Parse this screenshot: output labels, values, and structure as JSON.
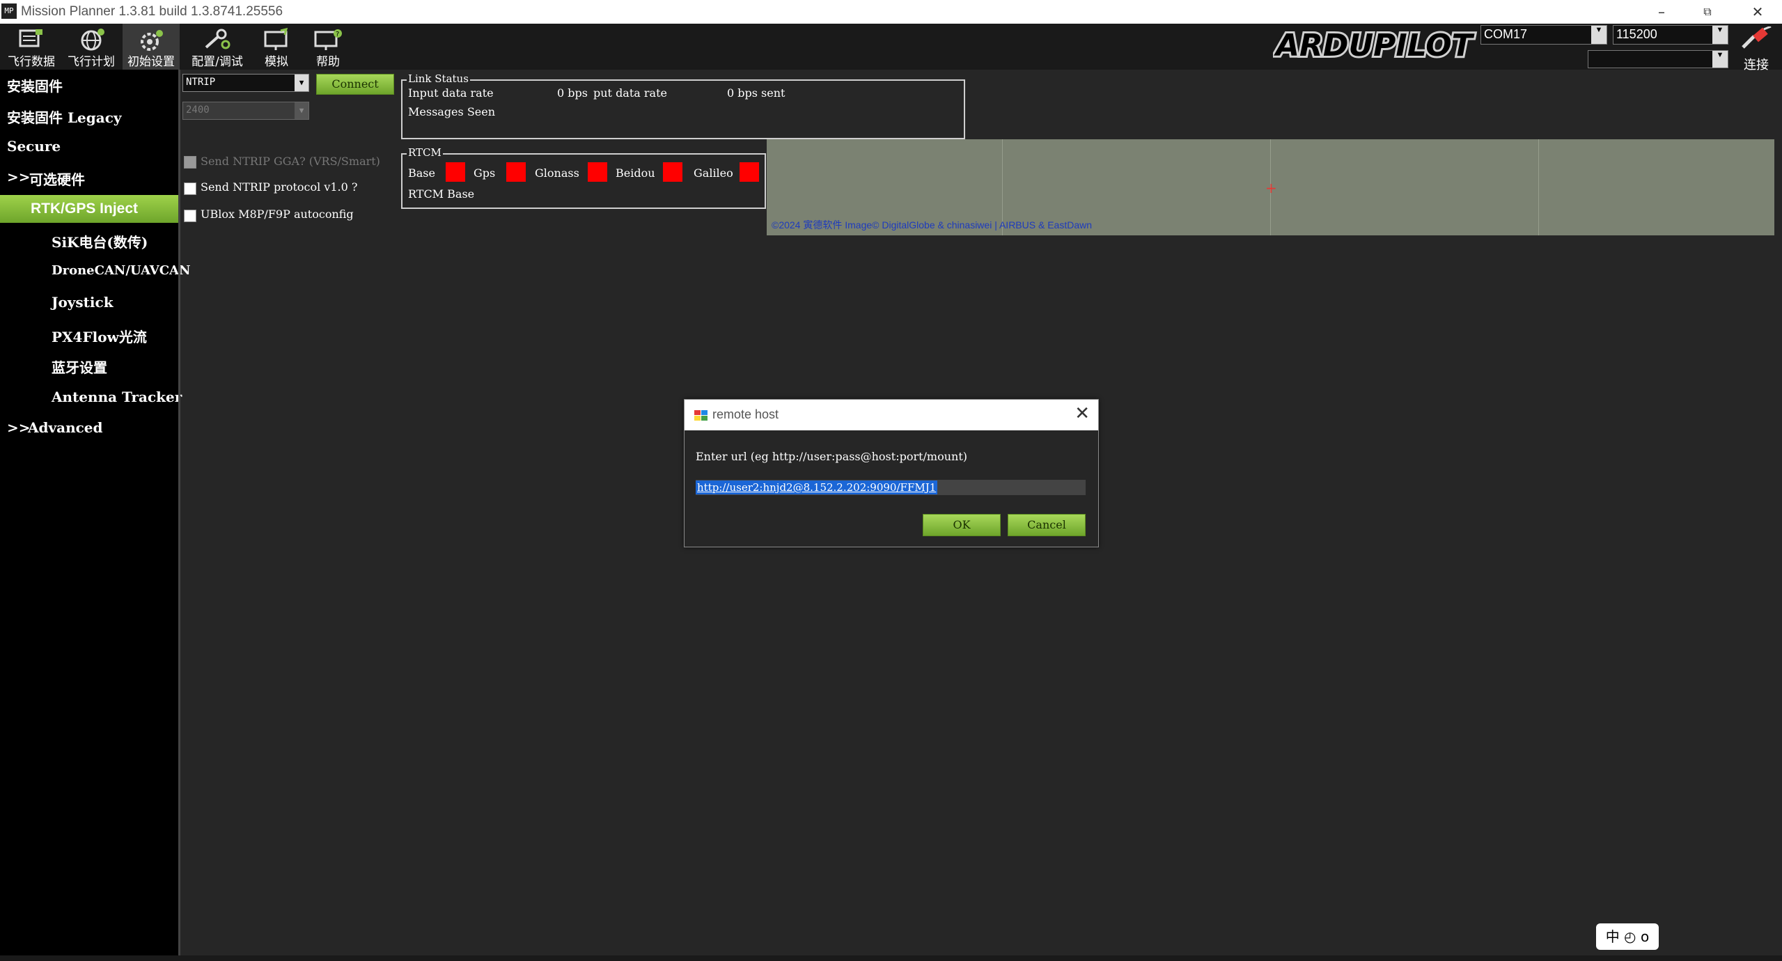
{
  "window": {
    "title": "Mission Planner 1.3.81 build 1.3.8741.25556",
    "app_icon_text": "MP"
  },
  "toolbar": {
    "items": [
      {
        "label": "飞行数据",
        "icon": "flight-data-icon"
      },
      {
        "label": "飞行计划",
        "icon": "flight-plan-icon"
      },
      {
        "label": "初始设置",
        "icon": "initial-setup-icon"
      },
      {
        "label": "配置/调试",
        "icon": "config-tuning-icon"
      },
      {
        "label": "模拟",
        "icon": "simulation-icon"
      },
      {
        "label": "帮助",
        "icon": "help-icon"
      }
    ],
    "logo_text": "ARDUPILOT",
    "port_value": "COM17",
    "baud_value": "115200",
    "secondary_value": "",
    "connect_label": "连接"
  },
  "sidebar": {
    "items": [
      {
        "label": "安装固件"
      },
      {
        "label": "安装固件 Legacy"
      },
      {
        "label": "Secure"
      },
      {
        "label": "可选硬件",
        "prefix": ">>"
      },
      {
        "label": "RTK/GPS Inject"
      },
      {
        "label": "SiK电台(数传)"
      },
      {
        "label": "DroneCAN/UAVCAN"
      },
      {
        "label": "Joystick"
      },
      {
        "label": "PX4Flow光流"
      },
      {
        "label": "蓝牙设置"
      },
      {
        "label": "Antenna Tracker"
      },
      {
        "label": "Advanced",
        "prefix": ">>"
      }
    ]
  },
  "rtk": {
    "source_value": "NTRIP",
    "baud_value": "2400",
    "connect_label": "Connect",
    "checks": [
      {
        "label": "Send NTRIP GGA? (VRS/Smart)",
        "checked": false,
        "disabled": true
      },
      {
        "label": "Send NTRIP protocol v1.0 ?",
        "checked": false,
        "disabled": false
      },
      {
        "label": "UBlox M8P/F9P autoconfig",
        "checked": false,
        "disabled": false
      }
    ],
    "link_status": {
      "title": "Link Status",
      "input_label": "Input data rate",
      "input_value": "0 bps",
      "output_label": "put data rate",
      "output_value": "0 bps sent",
      "messages_label": "Messages Seen"
    },
    "rtcm": {
      "title": "RTCM",
      "labels": [
        "Base",
        "Gps",
        "Glonass",
        "Beidou",
        "Galileo"
      ],
      "status_color": "#ff0000",
      "base_label": "RTCM Base"
    },
    "map_credit": "©2024 寅德软件 Image© DigitalGlobe & chinasiwei | AIRBUS & EastDawn"
  },
  "dialog": {
    "title": "remote host",
    "prompt": "Enter url (eg http://user:pass@host:port/mount)",
    "url_value": "http://user2:hnjd2@8.152.2.202:9090/FFMJ1",
    "ok_label": "OK",
    "cancel_label": "Cancel"
  },
  "tray": {
    "text": "中 ◴ o"
  }
}
